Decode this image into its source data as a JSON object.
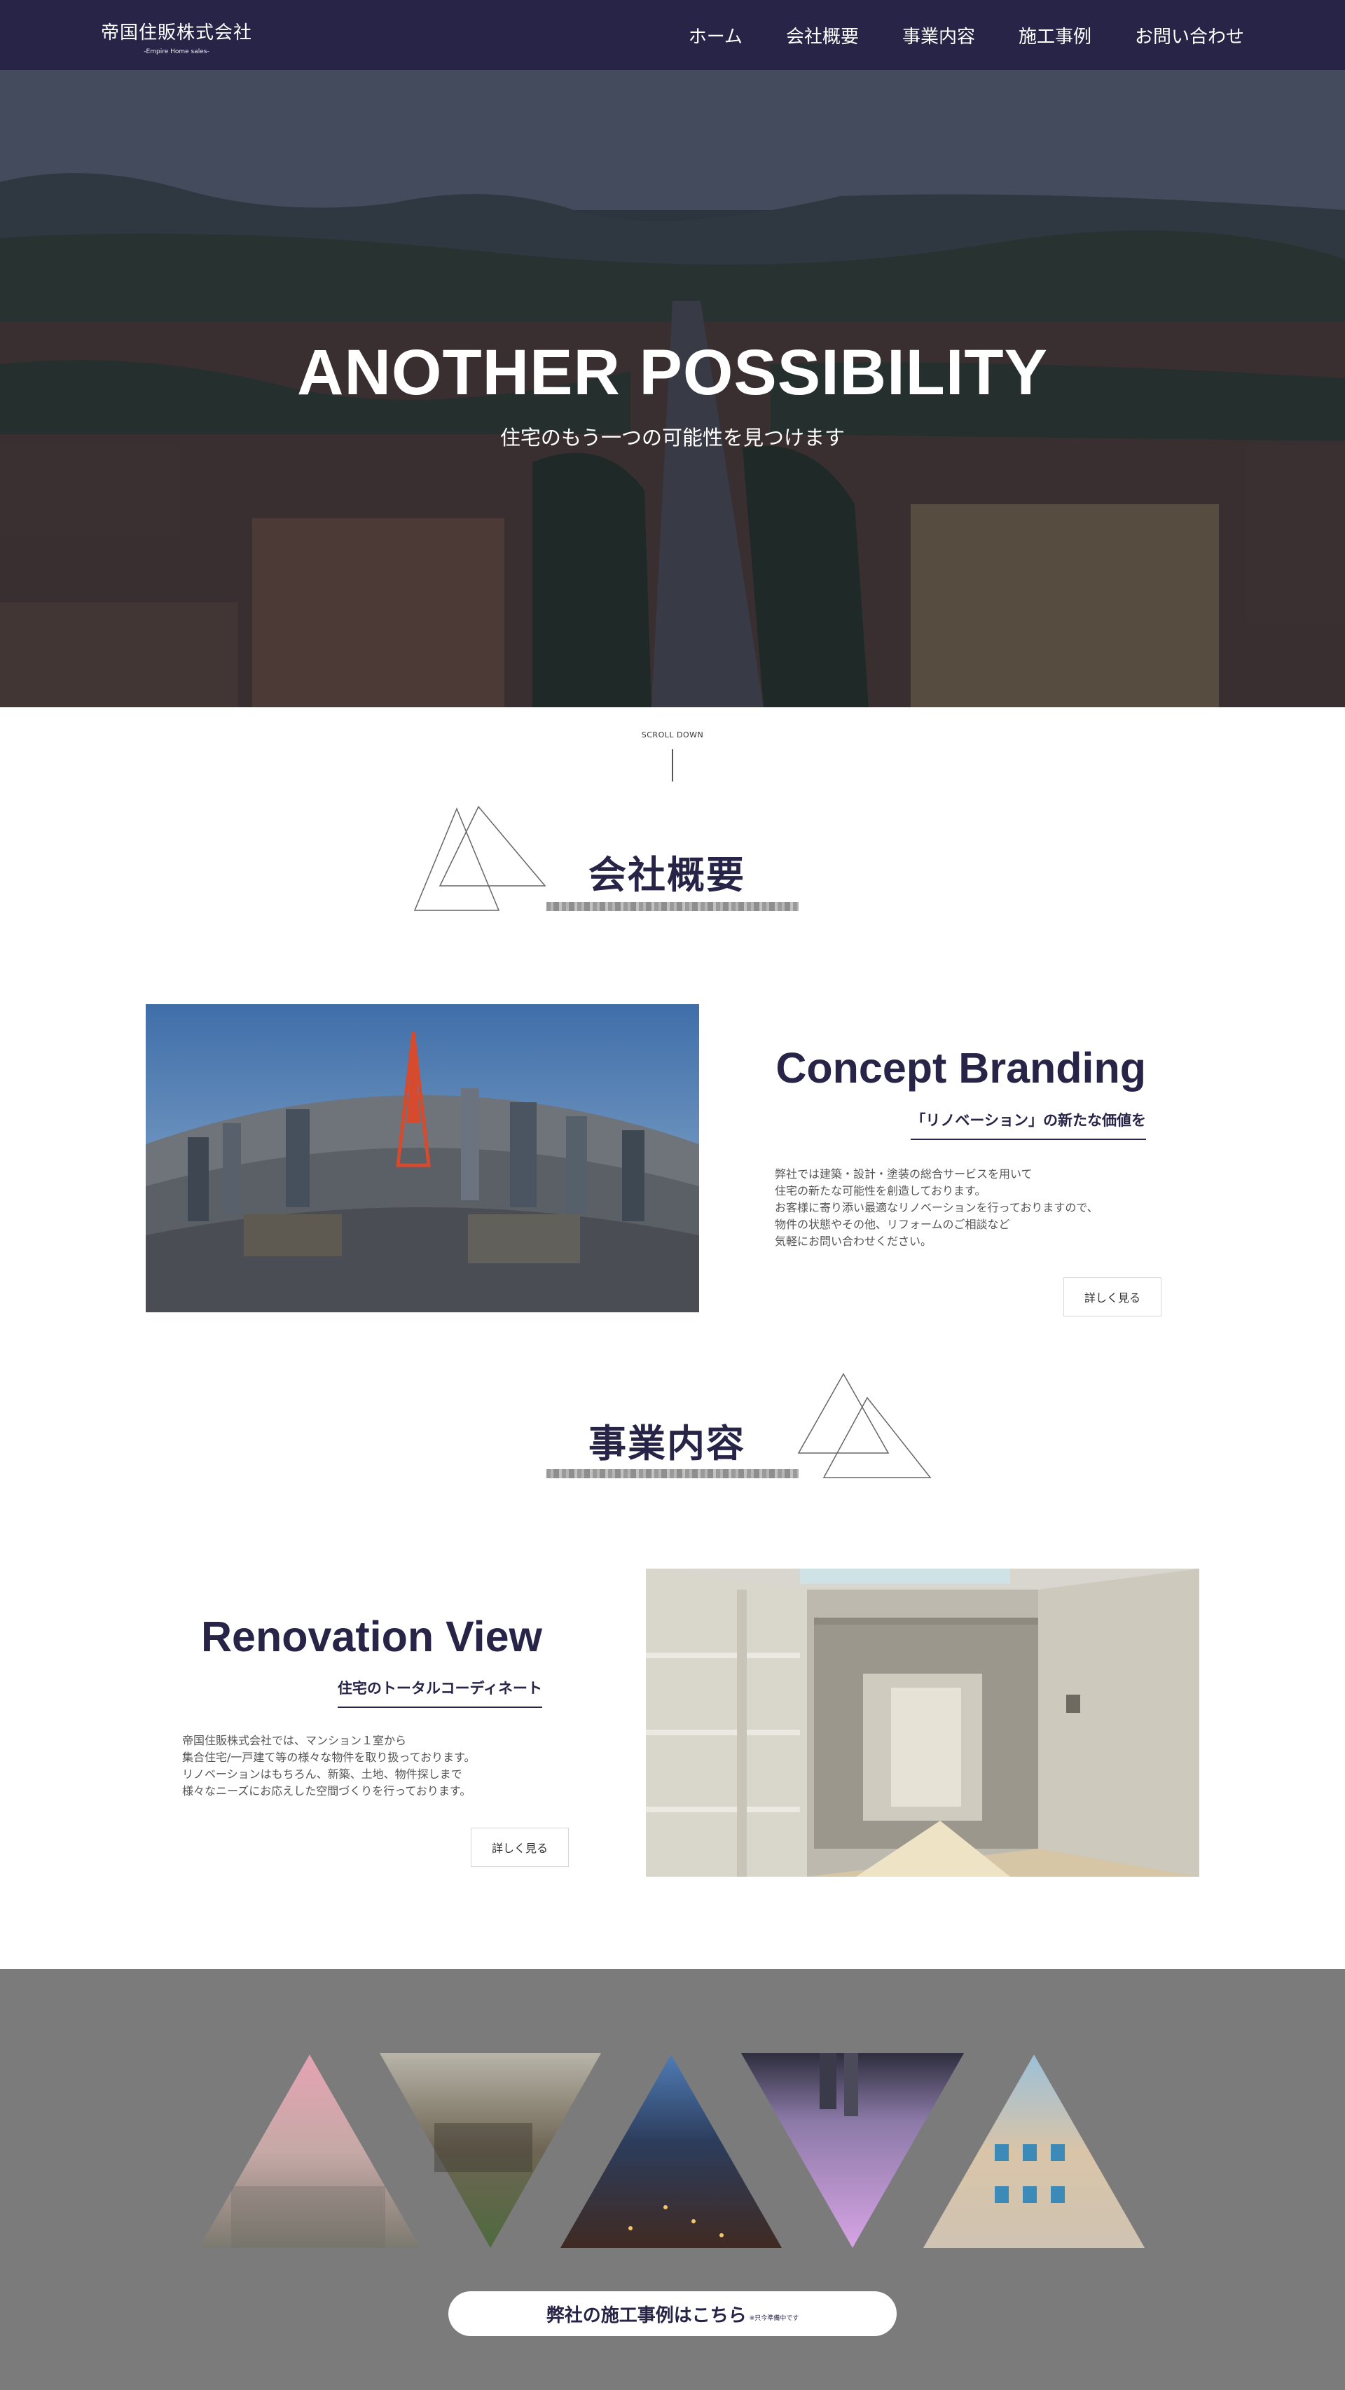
{
  "header": {
    "logo": "帝国住販株式会社",
    "logo_sub": "-Empire Home sales-",
    "nav": [
      "ホーム",
      "会社概要",
      "事業内容",
      "施工事例",
      "お問い合わせ"
    ]
  },
  "hero": {
    "title": "ANOTHER POSSIBILITY",
    "subtitle": "住宅のもう一つの可能性を見つけます"
  },
  "scroll": {
    "label": "SCROLL DOWN"
  },
  "company": {
    "heading": "会社概要",
    "title": "Concept Branding",
    "tagline": "「リノベーション」の新たな価値を",
    "body": [
      "弊社では建築・設計・塗装の総合サービスを用いて",
      "住宅の新たな可能性を創造しております。",
      "お客様に寄り添い最適なリノベーションを行っておりますので、",
      "物件の状態やその他、リフォームのご相談など",
      "気軽にお問い合わせください。"
    ],
    "button": "詳しく見る"
  },
  "business": {
    "heading": "事業内容",
    "title": "Renovation View",
    "tagline": "住宅のトータルコーディネート",
    "body": [
      "帝国住販株式会社では、マンション１室から",
      "集合住宅/一戸建て等の様々な物件を取り扱っております。",
      "リノベーションはもちろん、新築、土地、物件探しまで",
      "様々なニーズにお応えした空間づくりを行っております。"
    ],
    "button": "詳しく見る"
  },
  "gallery": {
    "cta": "弊社の施工事例はこちら",
    "cta_note": "※只今準備中です"
  },
  "colors": {
    "navy": "#272447",
    "gallery_bg": "#7b7b7b"
  }
}
